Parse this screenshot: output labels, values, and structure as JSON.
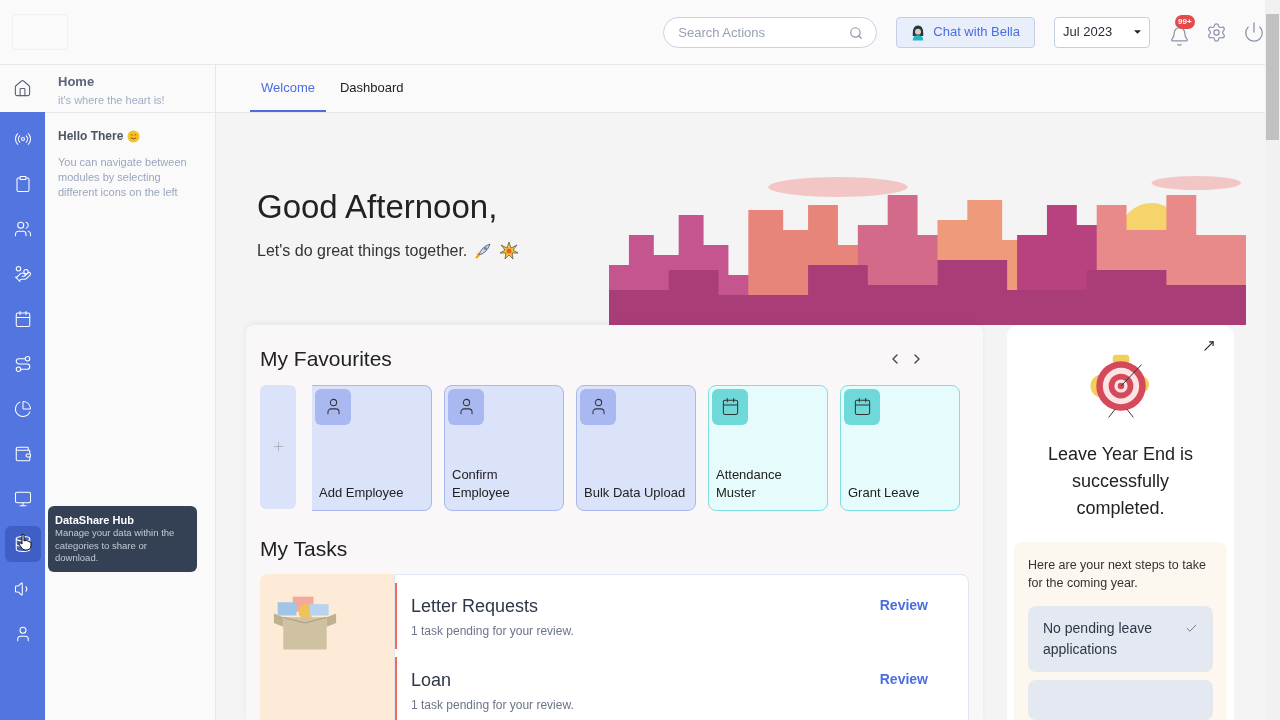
{
  "topbar": {
    "search": {
      "placeholder": "Search Actions"
    },
    "chat_button": "Chat with Bella",
    "period": "Jul 2023",
    "notifications_badge": "99+"
  },
  "rail": {
    "items": [
      {
        "kind": "broadcast",
        "selected": false
      },
      {
        "kind": "clipboard",
        "selected": false
      },
      {
        "kind": "users",
        "selected": false
      },
      {
        "kind": "hand",
        "selected": false
      },
      {
        "kind": "calendar",
        "selected": false
      },
      {
        "kind": "route",
        "selected": false
      },
      {
        "kind": "pie",
        "selected": false
      },
      {
        "kind": "wallet",
        "selected": false
      },
      {
        "kind": "monitor",
        "selected": false
      },
      {
        "kind": "database",
        "selected": true
      },
      {
        "kind": "megaphone",
        "selected": false
      },
      {
        "kind": "user",
        "selected": false
      }
    ],
    "tooltip": {
      "title": "DataShare Hub",
      "text": "Manage your data within the categories to share or download."
    }
  },
  "sidebar": {
    "title": "Home",
    "subtitle": "it's where the heart is!",
    "greeting": "Hello There",
    "help": "You can navigate between modules by selecting different icons on the left"
  },
  "tabs": [
    {
      "label": "Welcome",
      "selected": true
    },
    {
      "label": "Dashboard",
      "selected": false
    }
  ],
  "hero": {
    "title": "Good Afternoon,",
    "subtitle": "Let's do great things together."
  },
  "favourites": {
    "title": "My Favourites",
    "items": [
      {
        "label": "Add Employee",
        "kind": "employee"
      },
      {
        "label": "Confirm Employee",
        "kind": "employee"
      },
      {
        "label": "Bulk Data Upload",
        "kind": "employee"
      },
      {
        "label": "Attendance Muster",
        "kind": "attendance"
      },
      {
        "label": "Grant Leave",
        "kind": "attendance"
      }
    ]
  },
  "tasks": {
    "title": "My Tasks",
    "items": [
      {
        "title": "Letter Requests",
        "detail": "1 task pending for your review.",
        "action": "Review"
      },
      {
        "title": "Loan",
        "detail": "1 task pending for your review.",
        "action": "Review"
      }
    ]
  },
  "year_end": {
    "message": "Leave Year End is successfully completed.",
    "steps_intro": "Here are your next steps to take for the coming year.",
    "steps": [
      {
        "label": "No pending leave applications",
        "checked": true
      }
    ]
  }
}
